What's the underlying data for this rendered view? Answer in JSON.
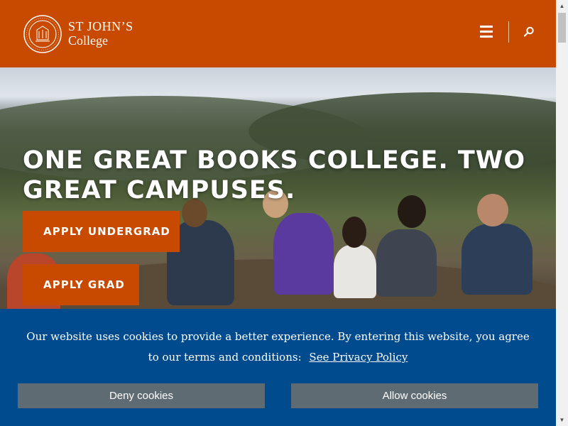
{
  "header": {
    "logo_line1": "ST JOHN’S",
    "logo_line2": "College",
    "logo_icon": "college-seal-icon",
    "menu_icon": "hamburger-menu-icon",
    "search_icon": "search-icon",
    "background": "#c84a00"
  },
  "hero": {
    "headline": "ONE GREAT BOOKS COLLEGE. TWO GREAT CAMPUSES.",
    "apply_undergrad": "APPLY UNDERGRAD",
    "apply_grad": "APPLY GRAD"
  },
  "cookie": {
    "message": "Our website uses cookies to provide a better experience. By entering this website, you agree to our terms and conditions:",
    "policy_link": "See Privacy Policy",
    "deny_label": "Deny cookies",
    "allow_label": "Allow cookies",
    "background": "#004b8d",
    "button_color": "#5f6b73"
  },
  "scrollbar": {
    "up_icon": "scroll-up-arrow-icon",
    "down_icon": "scroll-down-arrow-icon"
  }
}
